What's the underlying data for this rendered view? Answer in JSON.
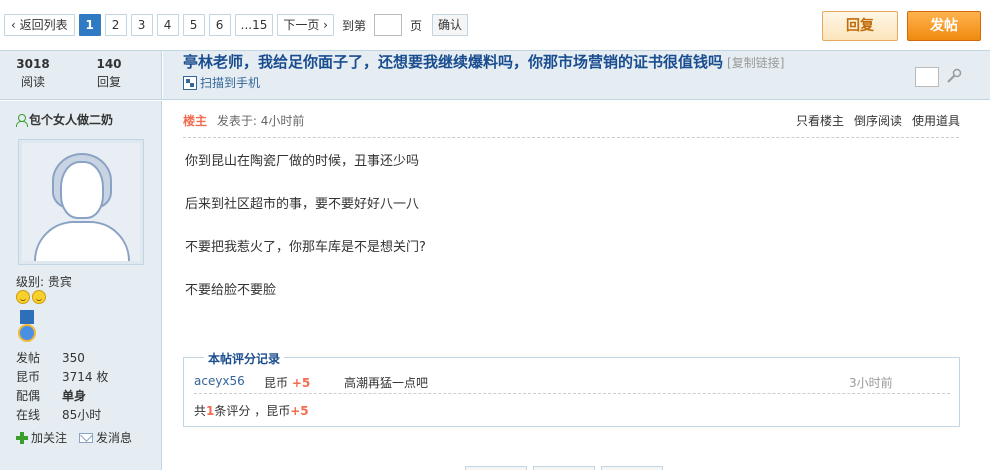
{
  "pager": {
    "back_label": "‹ 返回列表",
    "pages": [
      "1",
      "2",
      "3",
      "4",
      "5",
      "6",
      "...15"
    ],
    "current_page": "1",
    "next_label": "下一页 ›",
    "jump_prefix": "到第",
    "jump_suffix": "页",
    "confirm_label": "确认"
  },
  "toolbar": {
    "reply_label": "回复",
    "post_label": "发帖"
  },
  "thread": {
    "views": "3018",
    "views_label": "阅读",
    "replies": "140",
    "replies_label": "回复",
    "title": "亭林老师，我给足你面子了，还想要我继续爆料吗，你那市场营销的证书很值钱吗",
    "copy_link": "[复制链接]",
    "scan_label": "扫描到手机"
  },
  "author": {
    "name": "包个女人做二奶",
    "level": "级别: 贵宾",
    "stats": [
      {
        "key": "发帖",
        "value": "350",
        "bold": false
      },
      {
        "key": "昆币",
        "value": "3714 枚",
        "bold": false
      },
      {
        "key": "配偶",
        "value": "单身",
        "bold": true
      },
      {
        "key": "在线",
        "value": "85小时",
        "bold": false
      }
    ],
    "follow_label": "加关注",
    "message_label": "发消息"
  },
  "post": {
    "host_label": "楼主",
    "time": "发表于: 4小时前",
    "tools": [
      "只看楼主",
      "倒序阅读",
      "使用道具"
    ],
    "paragraphs": [
      "你到昆山在陶瓷厂做的时候，丑事还少吗",
      "后来到社区超市的事，要不要好好八一八",
      "不要把我惹火了，你那车库是不是想关门?",
      "不要给脸不要脸"
    ]
  },
  "rating": {
    "legend": "本帖评分记录",
    "row": {
      "user": "aceyx56",
      "currency": "昆币",
      "amount": "+5",
      "reason": "高潮再猛一点吧",
      "time": "3小时前"
    },
    "summary_prefix": "共",
    "summary_count": "1",
    "summary_mid": "条评分 ，昆币",
    "summary_amount": "+5"
  }
}
